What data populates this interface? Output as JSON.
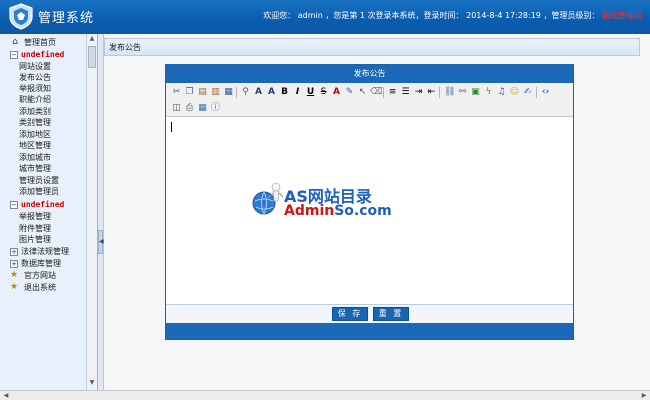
{
  "app": {
    "title": "管理系统",
    "welcome_prefix": "欢迎您：",
    "user": "admin",
    "login_info": "，您是第 1 次登录本系统，登录时间：",
    "login_time": "2014-8-4 17:28:19",
    "level_label": "，管理员级别：",
    "level_value": "超级管理员"
  },
  "sidebar": {
    "home": "管理首页",
    "group1_title": "undefined",
    "group1_items": [
      "网站设置",
      "发布公告",
      "举报须知",
      "职能介绍",
      "添加类别",
      "类别管理",
      "添加地区",
      "地区管理",
      "添加城市",
      "城市管理",
      "管理员设置",
      "添加管理员"
    ],
    "group2_title": "undefined",
    "group2_items": [
      "举报管理",
      "附件管理",
      "图片管理"
    ],
    "law": "法律法规管理",
    "db": "数据库管理",
    "official": "官方网站",
    "logout": "退出系统"
  },
  "content": {
    "breadcrumb": "发布公告",
    "panel_title": "发布公告",
    "save_label": "保 存",
    "reset_label": "重 置"
  },
  "watermark": {
    "title": "AS网站目录",
    "sub_a": "Admin",
    "sub_b": "So.com"
  },
  "toolbar_icons": [
    "cut-icon",
    "copy-icon",
    "paste-icon",
    "paste-text-icon",
    "paste-word-icon",
    "find-replace-icon",
    "font-family-icon",
    "font-size-icon",
    "bold-icon",
    "italic-icon",
    "underline-icon",
    "strikethrough-icon",
    "font-color-icon",
    "highlight-icon",
    "select-all-icon",
    "clear-format-icon",
    "align-left-icon",
    "ordered-list-icon",
    "indent-icon",
    "outdent-icon",
    "link-icon",
    "unlink-icon",
    "image-icon",
    "flash-icon",
    "media-icon",
    "emoticon-icon",
    "edit-icon",
    "source-icon",
    "preview-icon",
    "print-icon",
    "table-icon",
    "about-icon"
  ]
}
